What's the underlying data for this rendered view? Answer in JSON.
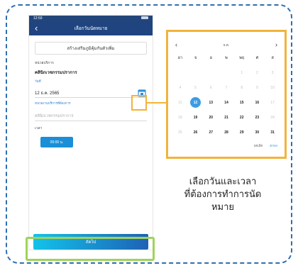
{
  "phone": {
    "status_time": "12:59",
    "nav_title": "เลือกวันนัดหมาย",
    "link_button": "สร้างเสริมภูมิคุ้มกันตัวเพิ่ม",
    "unit_label": "หน่วยบริการ",
    "unit_value": "คลินิกเวชกรรมปราการ",
    "date_label": "วันที่",
    "date_value": "12 ธ.ค. 2565",
    "unit_field_label": "หน่วยงานบริการที่ต้องการ",
    "unit_field_value": "คลินิกเวชกรรมปราการ",
    "time_label": "เวลา",
    "time_button": "09:00 น.",
    "next_button": "ถัดไป"
  },
  "calendar": {
    "prev": "‹",
    "next": "›",
    "month": "ธ.ค.",
    "weekdays": [
      "อา",
      "จ",
      "อ",
      "พ",
      "พฤ",
      "ศ",
      "ส"
    ],
    "days": [
      {
        "label": "",
        "state": "dim"
      },
      {
        "label": "",
        "state": "dim"
      },
      {
        "label": "",
        "state": "dim"
      },
      {
        "label": "",
        "state": "dim"
      },
      {
        "label": "1",
        "state": "dim"
      },
      {
        "label": "2",
        "state": "dim"
      },
      {
        "label": "3",
        "state": "dim"
      },
      {
        "label": "4",
        "state": "dim"
      },
      {
        "label": "5",
        "state": "dim"
      },
      {
        "label": "6",
        "state": "dim"
      },
      {
        "label": "7",
        "state": "dim"
      },
      {
        "label": "8",
        "state": "dim"
      },
      {
        "label": "9",
        "state": "dim"
      },
      {
        "label": "10",
        "state": "dim"
      },
      {
        "label": "11",
        "state": "dim"
      },
      {
        "label": "12",
        "state": "selected"
      },
      {
        "label": "13",
        "state": "normal"
      },
      {
        "label": "14",
        "state": "normal"
      },
      {
        "label": "15",
        "state": "normal"
      },
      {
        "label": "16",
        "state": "normal"
      },
      {
        "label": "17",
        "state": "dim"
      },
      {
        "label": "18",
        "state": "dim"
      },
      {
        "label": "19",
        "state": "normal"
      },
      {
        "label": "20",
        "state": "normal"
      },
      {
        "label": "21",
        "state": "normal"
      },
      {
        "label": "22",
        "state": "normal"
      },
      {
        "label": "23",
        "state": "normal"
      },
      {
        "label": "24",
        "state": "dim"
      },
      {
        "label": "25",
        "state": "dim"
      },
      {
        "label": "26",
        "state": "normal"
      },
      {
        "label": "27",
        "state": "normal"
      },
      {
        "label": "28",
        "state": "normal"
      },
      {
        "label": "29",
        "state": "normal"
      },
      {
        "label": "30",
        "state": "normal"
      },
      {
        "label": "31",
        "state": "normal"
      }
    ],
    "cancel": "ยกเลิก",
    "ok": "ตกลง"
  },
  "caption": {
    "line1": "เลือกวันและเวลา",
    "line2": "ที่ต้องการทำการนัด",
    "line3": "หมาย"
  },
  "colors": {
    "frame": "#2f6fae",
    "highlight_calendar": "#f2b33a",
    "highlight_next": "#9fd35a",
    "nav": "#1f4480",
    "selected_day": "#3d9be3"
  }
}
